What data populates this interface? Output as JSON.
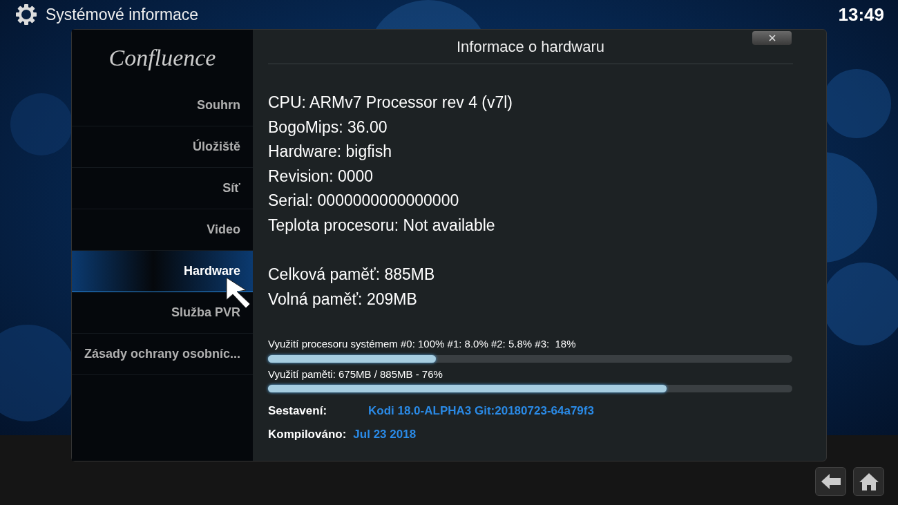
{
  "header": {
    "title": "Systémové informace",
    "clock": "13:49"
  },
  "sidebar": {
    "logo": "Confluence",
    "items": [
      {
        "label": "Souhrn",
        "selected": false
      },
      {
        "label": "Úložiště",
        "selected": false
      },
      {
        "label": "Síť",
        "selected": false
      },
      {
        "label": "Video",
        "selected": false
      },
      {
        "label": "Hardware",
        "selected": true
      },
      {
        "label": "Služba PVR",
        "selected": false
      },
      {
        "label": "Zásady ochrany osobníc...",
        "selected": false
      }
    ]
  },
  "content": {
    "heading": "Informace o hardwaru",
    "info_lines": [
      "CPU: ARMv7 Processor rev 4 (v7l)",
      "BogoMips: 36.00",
      "Hardware: bigfish",
      "Revision: 0000",
      "Serial: 0000000000000000",
      "Teplota procesoru: Not available"
    ],
    "memory_lines": [
      "Celková paměť: 885MB",
      "Volná paměť: 209MB"
    ],
    "meters": [
      {
        "label": "Využití procesoru systémem #0: 100% #1: 8.0% #2: 5.8% #3:  18%",
        "level": 0.32
      },
      {
        "label": "Využití paměti: 675MB / 885MB - 76%",
        "level": 0.76
      }
    ],
    "build": [
      {
        "label": "Sestavení:",
        "value": "Kodi 18.0-ALPHA3 Git:20180723-64a79f3"
      },
      {
        "label": "Kompilováno:",
        "value": "Jul 23 2018"
      }
    ]
  }
}
